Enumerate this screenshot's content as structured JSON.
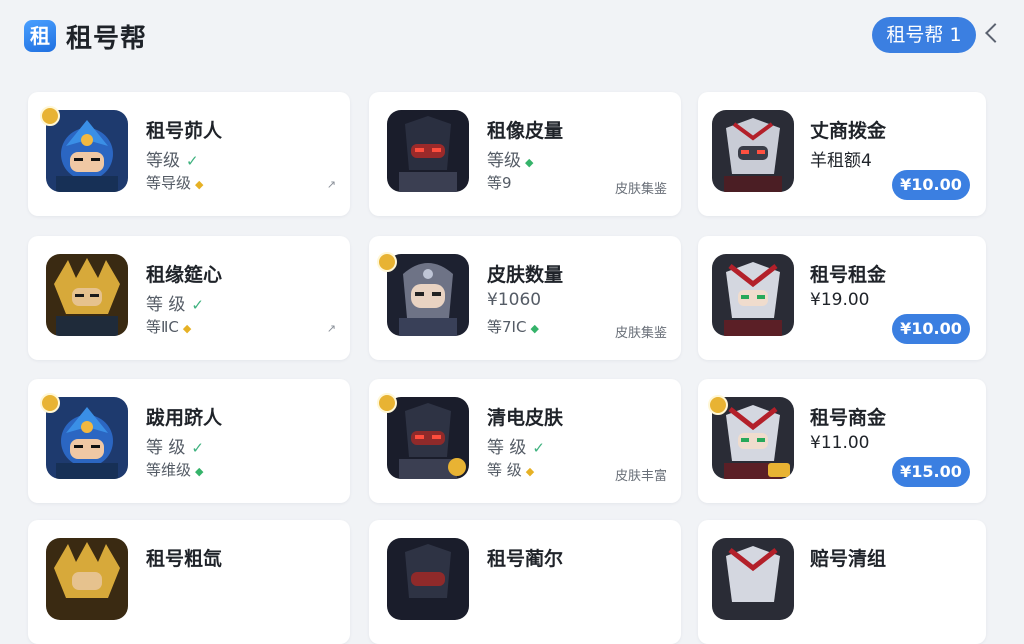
{
  "header": {
    "logo_char": "租",
    "app_name": "租号帮",
    "user_pill": "租号帮 1"
  },
  "colors": {
    "accent": "#3b7fe1",
    "gold": "#e8b333",
    "green": "#35b36a"
  },
  "cards": [
    {
      "name": "租号茆人",
      "line2": "等级",
      "line3": "等导级",
      "diamond": "gold",
      "right": "tick",
      "avatar": "blue-hood"
    },
    {
      "name": "租像皮量",
      "line2": "等级",
      "line3": "等9",
      "right_tag": "皮肤集鉴",
      "avatar": "dark-masked"
    },
    {
      "name": "丈商拨金",
      "line2": "羊租额4",
      "price": "¥10.00",
      "avatar": "silver-red"
    },
    {
      "name": "租缘筵心",
      "line2": "等 级",
      "line3": "等ⅡC",
      "diamond": "gold",
      "right": "tick",
      "avatar": "golden-warrior"
    },
    {
      "name": "皮肤数量",
      "line2": "¥1060",
      "line3": "等7IC",
      "diamond": "green",
      "right_tag": "皮肤集鉴",
      "avatar": "hooded-silver"
    },
    {
      "name": "租号租金",
      "line2": "¥19.00",
      "price": "¥10.00",
      "avatar": "silver-red"
    },
    {
      "name": "跋用跻人",
      "line2": "等 级",
      "line3": "等维级",
      "diamond": "green",
      "right": "",
      "avatar": "blue-hood"
    },
    {
      "name": "清电皮肤",
      "line2": "等 级",
      "line3": "等 级",
      "diamond": "gold",
      "right_tag": "皮肤丰富",
      "avatar": "dark-masked"
    },
    {
      "name": "租号商金",
      "line2": "¥11.00",
      "price": "¥15.00",
      "avatar": "silver-red"
    },
    {
      "name": "租号粗氙",
      "avatar": "golden-warrior"
    },
    {
      "name": "租号蔺尔",
      "avatar": "dark-masked"
    },
    {
      "name": "赔号清组",
      "avatar": "silver-red"
    }
  ]
}
